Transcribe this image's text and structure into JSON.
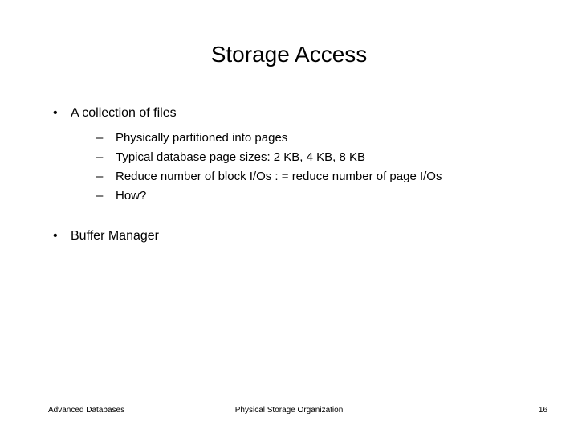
{
  "title": "Storage Access",
  "bullets": [
    {
      "text": "A collection of files",
      "sub": [
        "Physically partitioned into pages",
        "Typical database page sizes: 2 KB, 4 KB, 8 KB",
        "Reduce number of block I/Os : = reduce number of page I/Os",
        "How?"
      ]
    },
    {
      "text": "Buffer Manager",
      "sub": []
    }
  ],
  "footer": {
    "left": "Advanced Databases",
    "center": "Physical Storage Organization",
    "page": "16"
  }
}
